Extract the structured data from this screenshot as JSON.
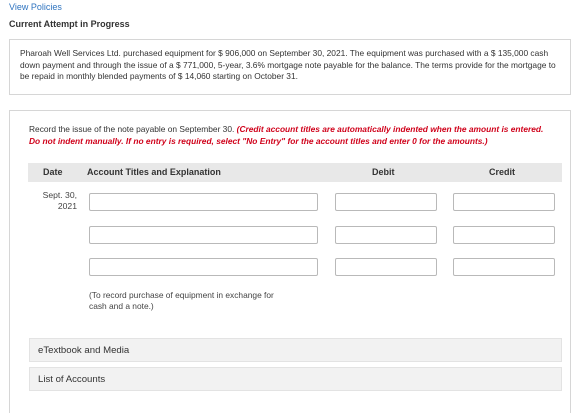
{
  "header": {
    "view_policies": "View Policies",
    "attempt_status": "Current Attempt in Progress"
  },
  "problem": {
    "text": "Pharoah Well Services Ltd. purchased equipment for $ 906,000 on September 30, 2021. The equipment was purchased with a $ 135,000 cash down payment and through the issue of a $ 771,000, 5-year, 3.6% mortgage note payable for the balance. The terms provide for the mortgage to be repaid in monthly blended payments of $ 14,060 starting on October 31."
  },
  "instructions": {
    "text": "Record the issue of the note payable on September 30. ",
    "red_text": "(Credit account titles are automatically indented when the amount is entered. Do not indent manually. If no entry is required, select \"No Entry\" for the account titles and enter 0 for the amounts.)"
  },
  "table": {
    "headers": {
      "date": "Date",
      "account": "Account Titles and Explanation",
      "debit": "Debit",
      "credit": "Credit"
    },
    "date_value": "Sept. 30, 2021",
    "rows": [
      {
        "account": "",
        "debit": "",
        "credit": ""
      },
      {
        "account": "",
        "debit": "",
        "credit": ""
      },
      {
        "account": "",
        "debit": "",
        "credit": ""
      }
    ],
    "explanation": "(To record purchase of equipment in exchange for cash and a note.)"
  },
  "buttons": {
    "etextbook": "eTextbook and Media",
    "list_accounts": "List of Accounts"
  },
  "colors": {
    "link": "#2f74c0",
    "red_instruction": "#d0021b",
    "header_bg": "#e8e8e8"
  }
}
